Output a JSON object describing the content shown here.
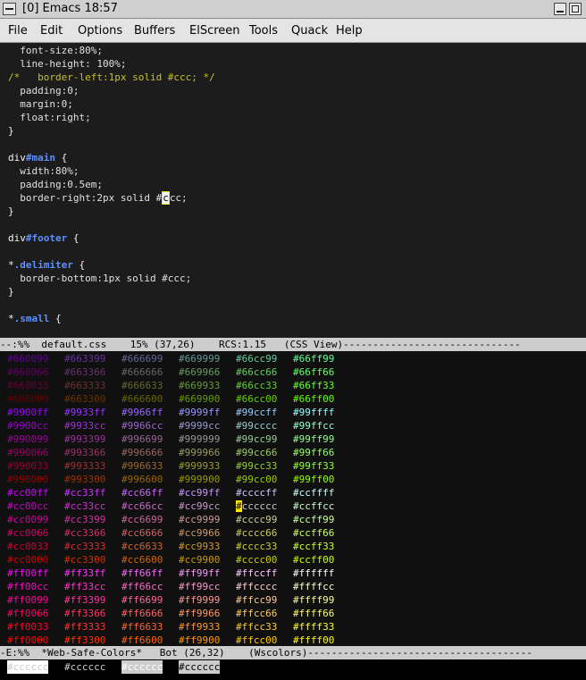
{
  "window": {
    "title": "[0] Emacs  18:57"
  },
  "menu": [
    "File",
    "Edit",
    "Options",
    "Buffers",
    "ElScreen",
    "Tools",
    "Quack",
    "Help"
  ],
  "code_lines": [
    [
      [
        "prop",
        "  font-size:80%;"
      ]
    ],
    [
      [
        "prop",
        "  line-height: 100%;"
      ]
    ],
    [
      [
        "cmt",
        "/*   border-left:1px solid #ccc; */"
      ]
    ],
    [
      [
        "prop",
        "  padding:0;"
      ]
    ],
    [
      [
        "prop",
        "  margin:0;"
      ]
    ],
    [
      [
        "prop",
        "  float:right;"
      ]
    ],
    [
      [
        "txt",
        "}"
      ]
    ],
    [
      [
        "txt",
        ""
      ]
    ],
    [
      [
        "txt",
        "div"
      ],
      [
        "sel",
        "#main"
      ],
      [
        "txt",
        " {"
      ]
    ],
    [
      [
        "prop",
        "  width:80%;"
      ]
    ],
    [
      [
        "prop",
        "  padding:0.5em;"
      ]
    ],
    [
      [
        "prop",
        "  border-right:2px solid #"
      ],
      [
        "cursor",
        "c"
      ],
      [
        "prop",
        "cc;"
      ]
    ],
    [
      [
        "txt",
        "}"
      ]
    ],
    [
      [
        "txt",
        ""
      ]
    ],
    [
      [
        "txt",
        "div"
      ],
      [
        "sel",
        "#footer"
      ],
      [
        "txt",
        " {"
      ]
    ],
    [
      [
        "txt",
        ""
      ]
    ],
    [
      [
        "txt",
        "*"
      ],
      [
        "sel",
        ".delimiter"
      ],
      [
        "txt",
        " {"
      ]
    ],
    [
      [
        "prop",
        "  border-bottom:1px solid #ccc;"
      ]
    ],
    [
      [
        "txt",
        "}"
      ]
    ],
    [
      [
        "txt",
        ""
      ]
    ],
    [
      [
        "txt",
        "*"
      ],
      [
        "sel",
        ".small"
      ],
      [
        "txt",
        " {"
      ]
    ]
  ],
  "modeline1": "--:%%  default.css    15% (37,26)    RCS:1.15   (CSS View)------------------------------",
  "color_rows": [
    [
      "#660099",
      "#663399",
      "#666699",
      "#669999",
      "#66cc99",
      "#66ff99"
    ],
    [
      "#660066",
      "#663366",
      "#666666",
      "#669966",
      "#66cc66",
      "#66ff66"
    ],
    [
      "#660033",
      "#663333",
      "#666633",
      "#669933",
      "#66cc33",
      "#66ff33"
    ],
    [
      "#660000",
      "#663300",
      "#666600",
      "#669900",
      "#66cc00",
      "#66ff00"
    ],
    [
      "#9900ff",
      "#9933ff",
      "#9966ff",
      "#9999ff",
      "#99ccff",
      "#99ffff"
    ],
    [
      "#9900cc",
      "#9933cc",
      "#9966cc",
      "#9999cc",
      "#99cccc",
      "#99ffcc"
    ],
    [
      "#990099",
      "#993399",
      "#996699",
      "#999999",
      "#99cc99",
      "#99ff99"
    ],
    [
      "#990066",
      "#993366",
      "#996666",
      "#999966",
      "#99cc66",
      "#99ff66"
    ],
    [
      "#990033",
      "#993333",
      "#996633",
      "#999933",
      "#99cc33",
      "#99ff33"
    ],
    [
      "#990000",
      "#993300",
      "#996600",
      "#999900",
      "#99cc00",
      "#99ff00"
    ],
    [
      "#cc00ff",
      "#cc33ff",
      "#cc66ff",
      "#cc99ff",
      "#ccccff",
      "#ccffff"
    ],
    [
      "#cc00cc",
      "#cc33cc",
      "#cc66cc",
      "#cc99cc",
      "#cccccc",
      "#ccffcc"
    ],
    [
      "#cc0099",
      "#cc3399",
      "#cc6699",
      "#cc9999",
      "#cccc99",
      "#ccff99"
    ],
    [
      "#cc0066",
      "#cc3366",
      "#cc6666",
      "#cc9966",
      "#cccc66",
      "#ccff66"
    ],
    [
      "#cc0033",
      "#cc3333",
      "#cc6633",
      "#cc9933",
      "#cccc33",
      "#ccff33"
    ],
    [
      "#cc0000",
      "#cc3300",
      "#cc6600",
      "#cc9900",
      "#cccc00",
      "#ccff00"
    ],
    [
      "#ff00ff",
      "#ff33ff",
      "#ff66ff",
      "#ff99ff",
      "#ffccff",
      "#ffffff"
    ],
    [
      "#ff00cc",
      "#ff33cc",
      "#ff66cc",
      "#ff99cc",
      "#ffcccc",
      "#ffffcc"
    ],
    [
      "#ff0099",
      "#ff3399",
      "#ff6699",
      "#ff9999",
      "#ffcc99",
      "#ffff99"
    ],
    [
      "#ff0066",
      "#ff3366",
      "#ff6666",
      "#ff9966",
      "#ffcc66",
      "#ffff66"
    ],
    [
      "#ff0033",
      "#ff3333",
      "#ff6633",
      "#ff9933",
      "#ffcc33",
      "#ffff33"
    ],
    [
      "#ff0000",
      "#ff3300",
      "#ff6600",
      "#ff9900",
      "#ffcc00",
      "#ffff00"
    ]
  ],
  "cursor_cell": {
    "row": 11,
    "col": 4
  },
  "modeline2": "-E:%%  *Web-Safe-Colors*   Bot (26,32)    (Wscolors)--------------------------------------",
  "minibuffer": [
    {
      "text": "#cccccc",
      "fg": "#cccccc",
      "bg": "#ffffff"
    },
    {
      "text": "#cccccc",
      "fg": "#cccccc",
      "bg": "#000000"
    },
    {
      "text": "#cccccc",
      "fg": "#ffffff",
      "bg": "#cccccc"
    },
    {
      "text": "#cccccc",
      "fg": "#000000",
      "bg": "#cccccc"
    }
  ]
}
